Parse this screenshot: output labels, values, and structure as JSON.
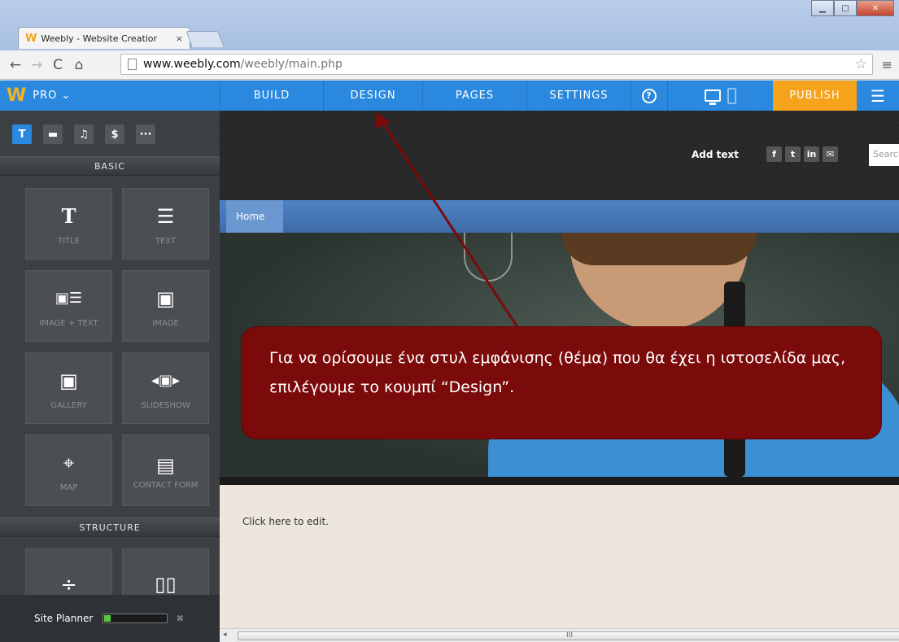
{
  "browser": {
    "tab_title": "Weebly - Website Creatior",
    "tab_close": "×",
    "url_host": "www.weebly.com",
    "url_path": "/weebly/main.php"
  },
  "weebly": {
    "plan": "PRO ⌄",
    "nav": {
      "build": "BUILD",
      "design": "DESIGN",
      "pages": "PAGES",
      "settings": "SETTINGS",
      "help": "?",
      "publish": "PUBLISH"
    },
    "sidebar": {
      "categories": [
        "T",
        "▬",
        "♫",
        "$",
        "···"
      ],
      "basic_label": "BASIC",
      "elements": [
        {
          "icon": "T",
          "label": "TITLE"
        },
        {
          "icon": "☰",
          "label": "TEXT"
        },
        {
          "icon": "▣☰",
          "label": "IMAGE + TEXT"
        },
        {
          "icon": "▣",
          "label": "IMAGE"
        },
        {
          "icon": "▣",
          "label": "GALLERY"
        },
        {
          "icon": "◂▣▸",
          "label": "SLIDESHOW"
        },
        {
          "icon": "⌖",
          "label": "MAP"
        },
        {
          "icon": "▤",
          "label": "CONTACT FORM"
        }
      ],
      "structure_label": "STRUCTURE",
      "structure_elements": [
        {
          "icon": "÷",
          "label": ""
        },
        {
          "icon": "▯▯",
          "label": ""
        }
      ],
      "site_planner_label": "Site Planner",
      "site_planner_progress": 0.1,
      "site_planner_close": "✖"
    },
    "site": {
      "add_text": "Add text",
      "social": [
        "f",
        "t",
        "in",
        "✉"
      ],
      "search_placeholder": "Search",
      "nav_home": "Home",
      "content_text": "Click here to edit.",
      "scroll_grip": "III"
    }
  },
  "annotation": {
    "text": "Για να ορίσουμε ένα στυλ εμφάνισης (θέμα) που θα έχει η ιστοσελίδα μας, επιλέγουμε το κουμπί “Design”."
  },
  "colors": {
    "weebly_blue": "#2a89de",
    "publish_orange": "#f7a21b",
    "callout_red": "#7b0a0a",
    "sidebar_dark": "#3d4043"
  }
}
